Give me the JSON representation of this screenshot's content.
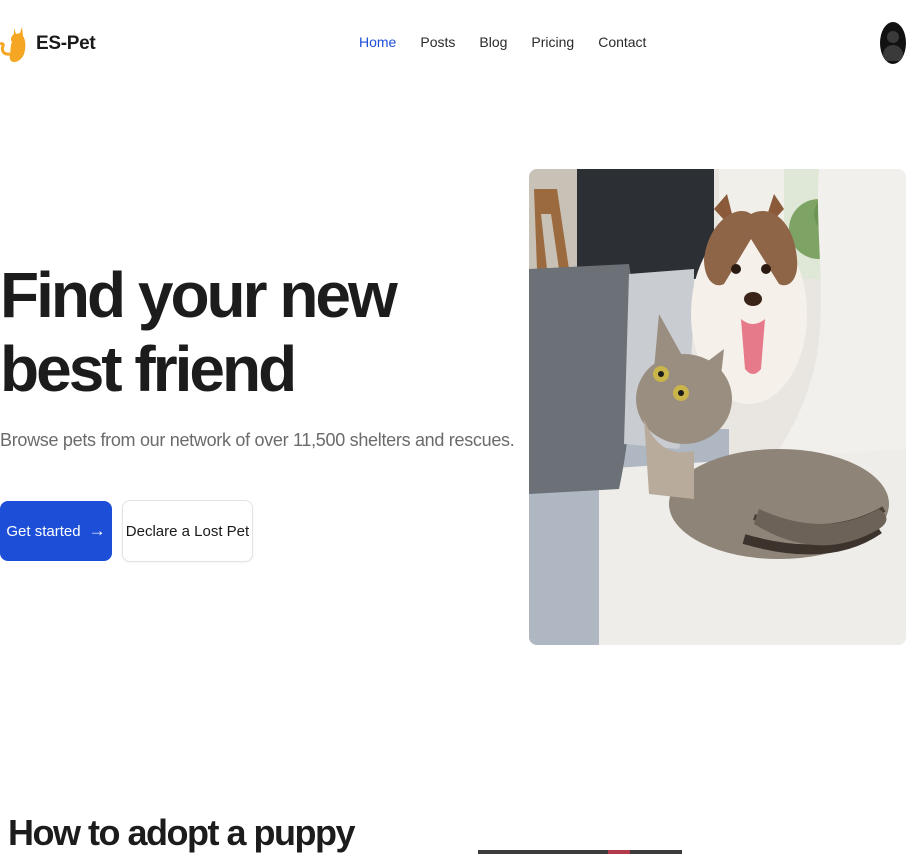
{
  "brand": {
    "name": "ES-Pet",
    "logo_icon": "cat-silhouette-icon",
    "accent": "#f5a623"
  },
  "nav": {
    "items": [
      {
        "label": "Home",
        "active": true
      },
      {
        "label": "Posts",
        "active": false
      },
      {
        "label": "Blog",
        "active": false
      },
      {
        "label": "Pricing",
        "active": false
      },
      {
        "label": "Contact",
        "active": false
      }
    ],
    "active_color": "#1d4ed8",
    "avatar_icon": "user-avatar-icon"
  },
  "hero": {
    "title": "Find your new best friend",
    "subtitle": "Browse pets from our network of over 11,500 shelters and rescues.",
    "primary_button": {
      "label": "Get started",
      "icon": "arrow-right-icon",
      "color": "#1d4ed8"
    },
    "secondary_button": {
      "label": "Declare a Lost Pet"
    },
    "image_alt": "cat and dog on a sofa"
  },
  "section": {
    "title": "How to adopt a puppy"
  }
}
